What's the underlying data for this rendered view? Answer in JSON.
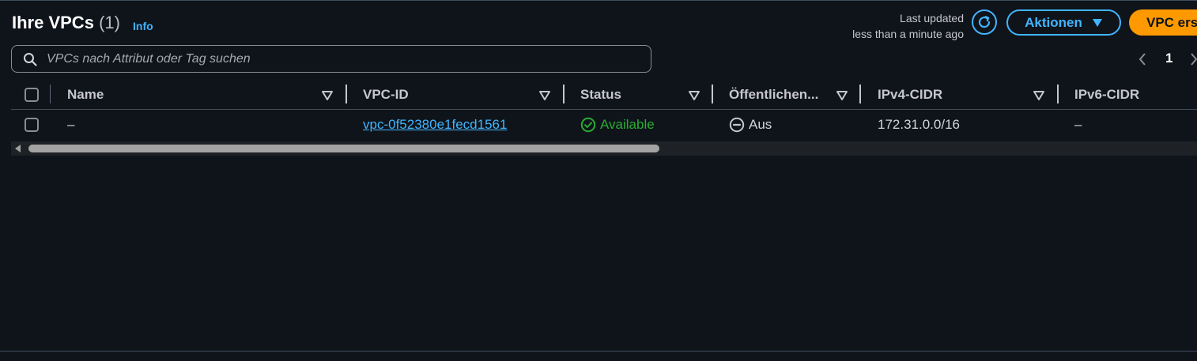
{
  "header": {
    "title": "Ihre VPCs",
    "count": "(1)",
    "info_label": "Info",
    "last_updated_line1": "Last updated",
    "last_updated_line2": "less than a minute ago",
    "actions_label": "Aktionen",
    "create_label": "VPC erst"
  },
  "search": {
    "placeholder": "VPCs nach Attribut oder Tag suchen",
    "value": ""
  },
  "pagination": {
    "current_page": "1"
  },
  "table": {
    "columns": [
      "Name",
      "VPC-ID",
      "Status",
      "Öffentlichen...",
      "IPv4-CIDR",
      "IPv6-CIDR"
    ],
    "rows": [
      {
        "name": "–",
        "vpc_id": "vpc-0f52380e1fecd1561",
        "status": "Available",
        "public_block": "Aus",
        "ipv4_cidr": "172.31.0.0/16",
        "ipv6_cidr": "–"
      }
    ]
  },
  "colors": {
    "accent": "#42b4ff",
    "primary_button": "#ff9900",
    "status_available": "#29ad32",
    "background": "#0f141a"
  },
  "icons": {
    "search": "search-icon",
    "refresh": "refresh-icon",
    "dropdown": "caret-down-icon",
    "sort": "sort-icon",
    "available": "check-circle-icon",
    "off": "minus-circle-icon"
  }
}
